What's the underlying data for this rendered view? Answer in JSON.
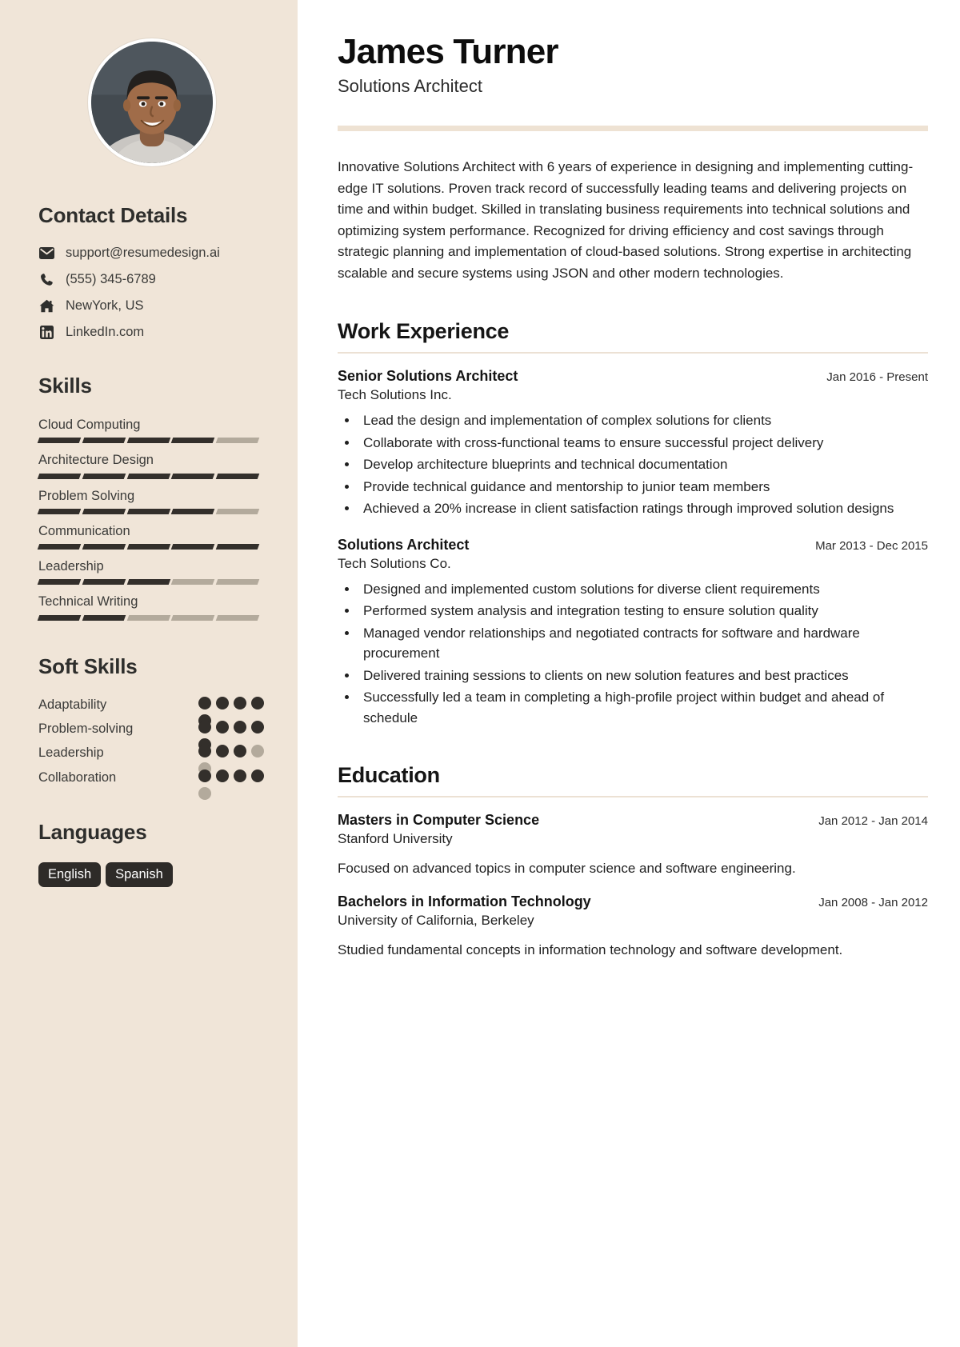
{
  "sidebar": {
    "avatar_alt": "profile-photo",
    "contact": {
      "heading": "Contact Details",
      "items": [
        {
          "icon": "envelope-icon",
          "value": "support@resumedesign.ai"
        },
        {
          "icon": "phone-icon",
          "value": "(555) 345-6789"
        },
        {
          "icon": "home-icon",
          "value": "NewYork, US"
        },
        {
          "icon": "linkedin-icon",
          "value": "LinkedIn.com"
        }
      ]
    },
    "skills": {
      "heading": "Skills",
      "max": 5,
      "items": [
        {
          "label": "Cloud Computing",
          "level": 4
        },
        {
          "label": "Architecture Design",
          "level": 5
        },
        {
          "label": "Problem Solving",
          "level": 4
        },
        {
          "label": "Communication",
          "level": 5
        },
        {
          "label": "Leadership",
          "level": 3
        },
        {
          "label": "Technical Writing",
          "level": 2
        }
      ]
    },
    "soft_skills": {
      "heading": "Soft Skills",
      "max": 5,
      "items": [
        {
          "label": "Adaptability",
          "level": 5
        },
        {
          "label": "Problem-solving",
          "level": 5
        },
        {
          "label": "Leadership",
          "level": 3
        },
        {
          "label": "Collaboration",
          "level": 4
        }
      ]
    },
    "languages": {
      "heading": "Languages",
      "items": [
        "English",
        "Spanish"
      ]
    }
  },
  "header": {
    "name": "James Turner",
    "role": "Solutions Architect"
  },
  "summary": "Innovative Solutions Architect with 6 years of experience in designing and implementing cutting-edge IT solutions. Proven track record of successfully leading teams and delivering projects on time and within budget. Skilled in translating business requirements into technical solutions and optimizing system performance. Recognized for driving efficiency and cost savings through strategic planning and implementation of cloud-based solutions. Strong expertise in architecting scalable and secure systems using JSON and other modern technologies.",
  "work": {
    "heading": "Work Experience",
    "entries": [
      {
        "title": "Senior Solutions Architect",
        "date": "Jan 2016 - Present",
        "org": "Tech Solutions Inc.",
        "bullets": [
          "Lead the design and implementation of complex solutions for clients",
          "Collaborate with cross-functional teams to ensure successful project delivery",
          "Develop architecture blueprints and technical documentation",
          "Provide technical guidance and mentorship to junior team members",
          "Achieved a 20% increase in client satisfaction ratings through improved solution designs"
        ]
      },
      {
        "title": "Solutions Architect",
        "date": "Mar 2013 - Dec 2015",
        "org": "Tech Solutions Co.",
        "bullets": [
          "Designed and implemented custom solutions for diverse client requirements",
          "Performed system analysis and integration testing to ensure solution quality",
          "Managed vendor relationships and negotiated contracts for software and hardware procurement",
          "Delivered training sessions to clients on new solution features and best practices",
          "Successfully led a team in completing a high-profile project within budget and ahead of schedule"
        ]
      }
    ]
  },
  "education": {
    "heading": "Education",
    "entries": [
      {
        "title": "Masters in Computer Science",
        "date": "Jan 2012 - Jan 2014",
        "org": "Stanford University",
        "description": "Focused on advanced topics in computer science and software engineering."
      },
      {
        "title": "Bachelors in Information Technology",
        "date": "Jan 2008 - Jan 2012",
        "org": "University of California, Berkeley",
        "description": "Studied fundamental concepts in information technology and software development."
      }
    ]
  },
  "colors": {
    "sidebar_bg": "#f0e5d8",
    "accent_rule": "#eee2d3",
    "dark": "#332f2b",
    "muted": "#b3aa9c"
  }
}
